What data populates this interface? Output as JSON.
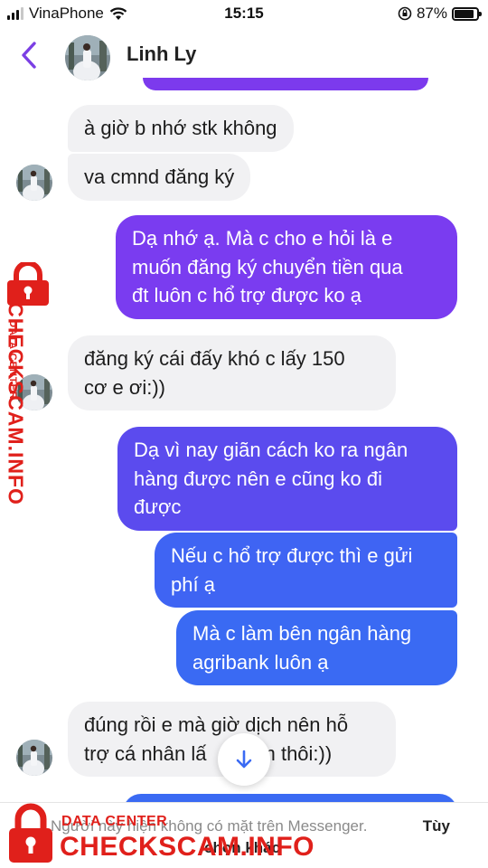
{
  "status_bar": {
    "carrier": "VinaPhone",
    "time": "15:15",
    "battery_percent": "87%",
    "battery_level": 0.87,
    "icons": [
      "signal-icon",
      "wifi-icon",
      "orientation-lock-icon",
      "battery-icon"
    ]
  },
  "header": {
    "contact_name": "Linh Ly",
    "back_icon": "chevron-left-icon"
  },
  "messages": [
    {
      "side": "in",
      "text": "à giờ b nhớ stk không"
    },
    {
      "side": "in",
      "text": "va cmnd đăng ký"
    },
    {
      "side": "out",
      "lines": [
        "Dạ nhớ ạ. Mà c cho e hỏi là e",
        "muốn đăng ký chuyển tiền qua",
        "đt luôn c hổ trợ được ko ạ"
      ]
    },
    {
      "side": "in",
      "lines": [
        "đăng ký cái đấy khó c lấy 150",
        "cơ e ơi:))"
      ]
    },
    {
      "side": "out",
      "lines": [
        "Dạ vì nay giãn cách ko ra ngân",
        "hàng được nên e cũng ko đi",
        "được"
      ]
    },
    {
      "side": "out",
      "lines": [
        "Nếu c hổ trợ được thì e gửi",
        "phí ạ"
      ]
    },
    {
      "side": "out",
      "lines": [
        "Mà c làm bên ngân hàng",
        "agribank luôn ạ"
      ]
    },
    {
      "side": "in",
      "lines": [
        "đúng rồi e mà giờ dịch nên hỗ",
        "trợ cá nhân lấ",
        "m thôi:))"
      ]
    }
  ],
  "bubble_colors": {
    "incoming": "#f1f1f3",
    "outgoing_1": "#7a3cf0",
    "outgoing_2": "#5b4bee",
    "outgoing_3": "#3f64f3",
    "outgoing_4": "#3a6af3",
    "accent": "#7c3aed"
  },
  "bottom_notice": {
    "text": "Người này hiện không có mặt trên Messenger.",
    "options_1": "Tùy",
    "options_2": "chọn khác"
  },
  "watermark": {
    "data_center": "DATA CENTER",
    "brand": "CHECKSCAM.INFO",
    "color": "#e0201b"
  }
}
